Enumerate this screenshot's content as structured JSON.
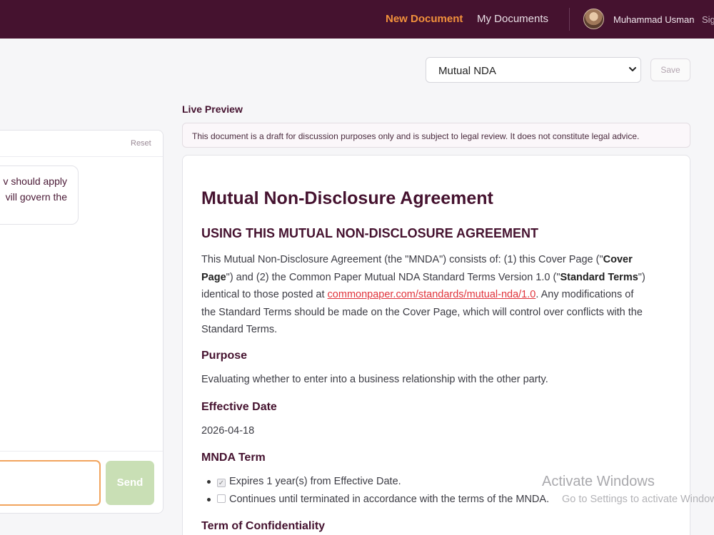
{
  "nav": {
    "new_document": "New Document",
    "my_documents": "My Documents",
    "user_name": "Muhammad Usman",
    "sign_out": "Sig"
  },
  "toolbar": {
    "document_type": "Mutual NDA",
    "save_label": "Save"
  },
  "chat": {
    "reset_label": "Reset",
    "bubble_line1": "v should apply",
    "bubble_line2": "vill govern the",
    "input_placeholder": "",
    "send_label": "Send"
  },
  "preview": {
    "label": "Live Preview",
    "disclaimer": "This document is a draft for discussion purposes only and is subject to legal review. It does not constitute legal advice.",
    "title": "Mutual Non-Disclosure Agreement",
    "subtitle": "USING THIS MUTUAL NON-DISCLOSURE AGREEMENT",
    "intro": {
      "p1": "This Mutual Non-Disclosure Agreement (the \"MNDA\") consists of: (1) this Cover Page (\"",
      "b1": "Cover",
      "b2": "Page",
      "p2": "\") and (2) the Common Paper Mutual NDA Standard Terms Version 1.0 (\"",
      "b3": "Standard Terms",
      "p3": "\")",
      "p4": "identical to those posted at ",
      "link": "commonpaper.com/standards/mutual-nda/1.0",
      "p5": ". Any modifications of",
      "p6": "the Standard Terms should be made on the Cover Page, which will control over conflicts with the",
      "p7": "Standard Terms."
    },
    "purpose_heading": "Purpose",
    "purpose_text": "Evaluating whether to enter into a business relationship with the other party.",
    "effective_date_heading": "Effective Date",
    "effective_date": "2026-04-18",
    "mnda_term_heading": "MNDA Term",
    "mnda_term_options": [
      {
        "label": "Expires 1 year(s) from Effective Date.",
        "checked": true
      },
      {
        "label": "Continues until terminated in accordance with the terms of the MNDA.",
        "checked": false
      }
    ],
    "confidentiality_heading": "Term of Confidentiality"
  },
  "watermark": {
    "line1": "Activate Windows",
    "line2": "Go to Settings to activate Windows."
  },
  "colors": {
    "brand": "#45122f",
    "accent": "#f2913c",
    "send_button": "#c9dfb5",
    "link": "#e0343c"
  }
}
